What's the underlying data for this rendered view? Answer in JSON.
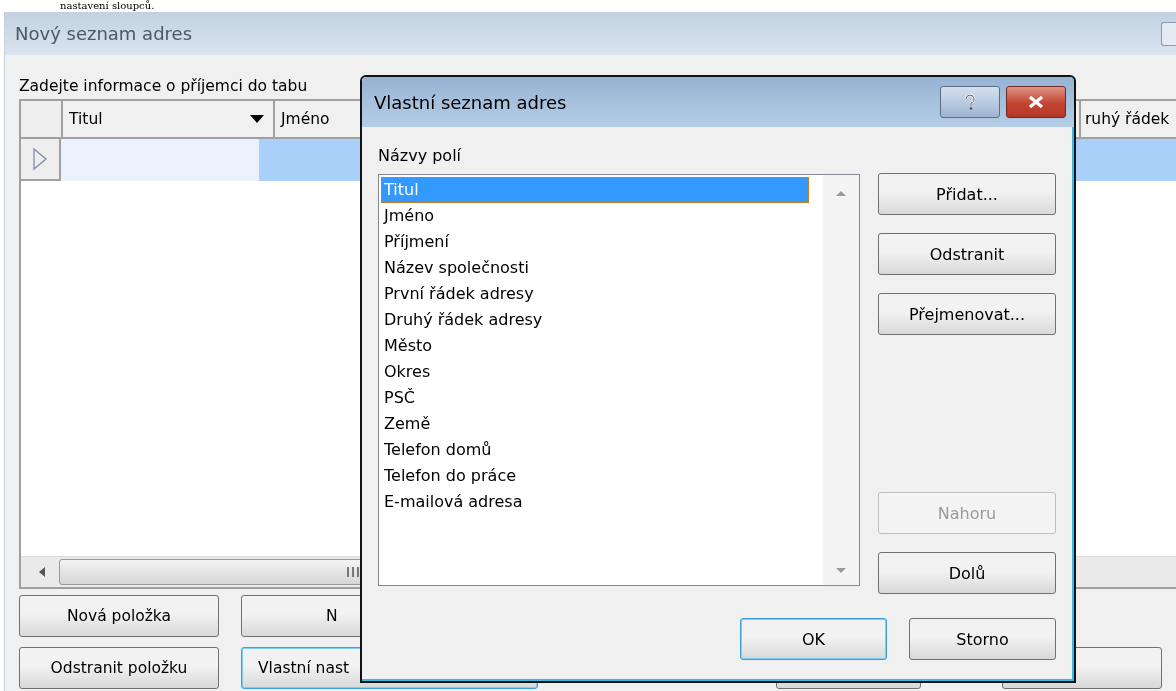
{
  "page_caption": "nastavení sloupců.",
  "window": {
    "title": "Nový seznam adres"
  },
  "instruction": "Zadejte informace o příjemci do tabu",
  "table": {
    "columns": [
      {
        "label": "Titul",
        "dropdown": true
      },
      {
        "label": "Jméno"
      },
      {
        "label": "ruhý řádek"
      }
    ],
    "rows": [
      {
        "selected": true
      }
    ]
  },
  "buttons": [
    {
      "label": "Nová položka"
    },
    {
      "label": "N"
    },
    {
      "label": "Odstranit položku"
    },
    {
      "label": "Vlastní nast"
    }
  ],
  "dialog": {
    "title": "Vlastní seznam adres",
    "list_label": "Názvy polí",
    "fields": [
      {
        "label": "Titul",
        "selected": true
      },
      {
        "label": "Jméno",
        "selected": false
      },
      {
        "label": "Příjmení",
        "selected": false
      },
      {
        "label": "Název společnosti",
        "selected": false
      },
      {
        "label": "První řádek adresy",
        "selected": false
      },
      {
        "label": "Druhý řádek adresy",
        "selected": false
      },
      {
        "label": "Město",
        "selected": false
      },
      {
        "label": "Okres",
        "selected": false
      },
      {
        "label": "PSČ",
        "selected": false
      },
      {
        "label": "Země",
        "selected": false
      },
      {
        "label": "Telefon domů",
        "selected": false
      },
      {
        "label": "Telefon do práce",
        "selected": false
      },
      {
        "label": "E-mailová adresa",
        "selected": false
      }
    ],
    "side_buttons": [
      {
        "label": "Přidat...",
        "disabled": false
      },
      {
        "label": "Odstranit",
        "disabled": false
      },
      {
        "label": "Přejmenovat...",
        "disabled": false
      },
      {
        "label": "Nahoru",
        "disabled": true
      },
      {
        "label": "Dolů",
        "disabled": false
      }
    ],
    "ok": "OK",
    "cancel": "Storno"
  }
}
